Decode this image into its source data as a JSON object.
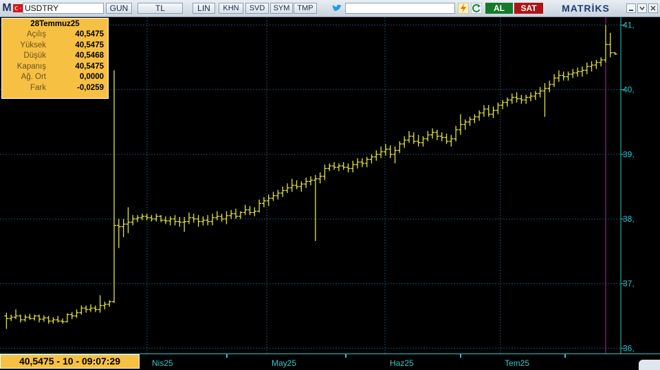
{
  "toolbar": {
    "logo_letter": "M",
    "symbol": "USDTRY",
    "buttons": [
      "GUN",
      "TL",
      "LIN",
      "KHN",
      "SVD",
      "SYM",
      "TMP"
    ],
    "buy_label": "AL",
    "sell_label": "SAT",
    "brand": "MATRİKS",
    "icons": [
      "flag-icon",
      "twitter-icon",
      "lightning-icon",
      "refresh-icon",
      "minimize-icon",
      "restore-icon",
      "close-icon"
    ]
  },
  "info_box": {
    "date": "28Temmuz25",
    "rows": [
      {
        "label": "Açılış",
        "value": "40,5475"
      },
      {
        "label": "Yüksek",
        "value": "40,5475"
      },
      {
        "label": "Düşük",
        "value": "40,5468"
      },
      {
        "label": "Kapanış",
        "value": "40,5475"
      },
      {
        "label": "Ağ. Ort",
        "value": "0,0000"
      },
      {
        "label": "Fark",
        "value": "-0,0259"
      }
    ]
  },
  "readout": "40,5475 - 10 - 09:07:29",
  "colors": {
    "background": "#000000",
    "bars": "#e6e63a",
    "grid": "#1f4a66",
    "axis": "#30c8d0",
    "info_bg": "#f6c043",
    "buy": "#157a2a",
    "sell": "#b01414"
  },
  "chart_data": {
    "type": "ohlc",
    "y_tick_labels": [
      "36,",
      "37,",
      "38,",
      "39,",
      "40,",
      "41,"
    ],
    "ylim": [
      35.95,
      41.1
    ],
    "x_tick_labels": [
      "Nis25",
      "May25",
      "Haz25",
      "Tem25"
    ],
    "x_ticks": [
      "Nis25",
      "May25",
      "Haz25",
      "Tem25"
    ],
    "series": [
      {
        "values": [
          [
            36.5,
            36.55,
            36.3,
            36.46
          ],
          [
            36.46,
            36.52,
            36.42,
            36.48
          ],
          [
            36.48,
            36.6,
            36.45,
            36.5
          ],
          [
            36.5,
            36.52,
            36.4,
            36.44
          ],
          [
            36.44,
            36.52,
            36.41,
            36.48
          ],
          [
            36.48,
            36.53,
            36.44,
            36.46
          ],
          [
            36.46,
            36.52,
            36.43,
            36.5
          ],
          [
            36.5,
            36.52,
            36.4,
            36.45
          ],
          [
            36.45,
            36.51,
            36.41,
            36.47
          ],
          [
            36.47,
            36.5,
            36.38,
            36.42
          ],
          [
            36.42,
            36.48,
            36.38,
            36.44
          ],
          [
            36.44,
            36.5,
            36.4,
            36.42
          ],
          [
            36.42,
            36.46,
            36.38,
            36.41
          ],
          [
            36.41,
            36.54,
            36.4,
            36.52
          ],
          [
            36.52,
            36.56,
            36.45,
            36.5
          ],
          [
            36.5,
            36.6,
            36.47,
            36.55
          ],
          [
            36.55,
            36.66,
            36.52,
            36.62
          ],
          [
            36.62,
            36.66,
            36.55,
            36.6
          ],
          [
            36.6,
            36.68,
            36.56,
            36.62
          ],
          [
            36.62,
            36.66,
            36.56,
            36.6
          ],
          [
            36.6,
            36.82,
            36.55,
            36.66
          ],
          [
            36.66,
            36.72,
            36.6,
            36.68
          ],
          [
            36.68,
            36.74,
            36.64,
            36.72
          ],
          [
            36.72,
            40.3,
            36.7,
            37.9
          ],
          [
            37.9,
            38.0,
            37.55,
            37.88
          ],
          [
            37.88,
            38.0,
            37.72,
            37.92
          ],
          [
            37.92,
            38.18,
            37.78,
            37.95
          ],
          [
            37.95,
            38.06,
            37.9,
            38.0
          ],
          [
            38.0,
            38.06,
            37.95,
            38.02
          ],
          [
            38.02,
            38.08,
            37.98,
            38.04
          ],
          [
            38.04,
            38.08,
            37.98,
            38.02
          ],
          [
            38.02,
            38.06,
            37.96,
            38.0
          ],
          [
            38.0,
            38.08,
            37.96,
            38.04
          ],
          [
            38.04,
            38.06,
            37.95,
            37.98
          ],
          [
            37.98,
            38.04,
            37.92,
            37.97
          ],
          [
            37.97,
            38.04,
            37.9,
            38.0
          ],
          [
            38.0,
            38.06,
            37.9,
            37.96
          ],
          [
            37.96,
            38.03,
            37.88,
            37.95
          ],
          [
            37.95,
            38.03,
            37.8,
            37.96
          ],
          [
            37.96,
            38.1,
            37.92,
            38.02
          ],
          [
            38.02,
            38.08,
            37.94,
            38.0
          ],
          [
            38.0,
            38.06,
            37.88,
            37.96
          ],
          [
            37.96,
            38.04,
            37.9,
            37.98
          ],
          [
            37.98,
            38.06,
            37.9,
            37.96
          ],
          [
            37.96,
            38.08,
            37.9,
            38.02
          ],
          [
            38.02,
            38.12,
            37.98,
            38.04
          ],
          [
            38.04,
            38.08,
            37.96,
            38.0
          ],
          [
            38.0,
            38.12,
            37.92,
            38.05
          ],
          [
            38.05,
            38.14,
            38.0,
            38.08
          ],
          [
            38.08,
            38.16,
            38.0,
            38.04
          ],
          [
            38.04,
            38.12,
            38.0,
            38.1
          ],
          [
            38.1,
            38.22,
            38.06,
            38.14
          ],
          [
            38.14,
            38.2,
            38.06,
            38.1
          ],
          [
            38.1,
            38.18,
            38.04,
            38.12
          ],
          [
            38.12,
            38.3,
            38.1,
            38.24
          ],
          [
            38.24,
            38.34,
            38.18,
            38.28
          ],
          [
            38.28,
            38.38,
            38.2,
            38.32
          ],
          [
            38.32,
            38.42,
            38.28,
            38.36
          ],
          [
            38.36,
            38.45,
            38.3,
            38.4
          ],
          [
            38.4,
            38.5,
            38.34,
            38.44
          ],
          [
            38.44,
            38.55,
            38.4,
            38.48
          ],
          [
            38.48,
            38.62,
            38.42,
            38.52
          ],
          [
            38.52,
            38.6,
            38.46,
            38.5
          ],
          [
            38.5,
            38.58,
            38.42,
            38.54
          ],
          [
            38.54,
            38.64,
            38.48,
            38.58
          ],
          [
            38.58,
            38.66,
            38.52,
            38.6
          ],
          [
            38.6,
            38.68,
            37.66,
            38.62
          ],
          [
            38.62,
            38.72,
            38.55,
            38.66
          ],
          [
            38.66,
            38.84,
            38.6,
            38.78
          ],
          [
            38.78,
            38.86,
            38.74,
            38.82
          ],
          [
            38.82,
            38.88,
            38.76,
            38.8
          ],
          [
            38.8,
            38.86,
            38.74,
            38.82
          ],
          [
            38.82,
            38.88,
            38.76,
            38.8
          ],
          [
            38.8,
            38.86,
            38.72,
            38.78
          ],
          [
            38.78,
            38.9,
            38.72,
            38.84
          ],
          [
            38.84,
            38.94,
            38.78,
            38.88
          ],
          [
            38.88,
            38.94,
            38.8,
            38.86
          ],
          [
            38.86,
            38.96,
            38.8,
            38.92
          ],
          [
            38.92,
            39.0,
            38.86,
            38.96
          ],
          [
            38.96,
            39.06,
            38.9,
            39.0
          ],
          [
            39.0,
            39.12,
            38.94,
            39.04
          ],
          [
            39.04,
            39.16,
            38.98,
            39.08
          ],
          [
            39.08,
            39.14,
            38.94,
            39.0
          ],
          [
            39.0,
            39.12,
            38.86,
            39.06
          ],
          [
            39.06,
            39.2,
            39.02,
            39.16
          ],
          [
            39.16,
            39.28,
            39.1,
            39.22
          ],
          [
            39.22,
            39.36,
            39.18,
            39.28
          ],
          [
            39.28,
            39.34,
            39.16,
            39.2
          ],
          [
            39.2,
            39.3,
            39.12,
            39.18
          ],
          [
            39.18,
            39.28,
            39.12,
            39.24
          ],
          [
            39.24,
            39.36,
            39.2,
            39.3
          ],
          [
            39.3,
            39.4,
            39.24,
            39.34
          ],
          [
            39.34,
            39.38,
            39.22,
            39.28
          ],
          [
            39.28,
            39.34,
            39.2,
            39.26
          ],
          [
            39.26,
            39.32,
            39.16,
            39.2
          ],
          [
            39.2,
            39.3,
            39.12,
            39.24
          ],
          [
            39.24,
            39.44,
            39.2,
            39.38
          ],
          [
            39.38,
            39.62,
            39.3,
            39.46
          ],
          [
            39.46,
            39.54,
            39.38,
            39.5
          ],
          [
            39.5,
            39.58,
            39.44,
            39.54
          ],
          [
            39.54,
            39.62,
            39.48,
            39.58
          ],
          [
            39.58,
            39.68,
            39.52,
            39.64
          ],
          [
            39.64,
            39.76,
            39.58,
            39.7
          ],
          [
            39.7,
            39.76,
            39.58,
            39.62
          ],
          [
            39.62,
            39.74,
            39.56,
            39.68
          ],
          [
            39.68,
            39.8,
            39.62,
            39.76
          ],
          [
            39.76,
            39.84,
            39.7,
            39.8
          ],
          [
            39.8,
            39.88,
            39.74,
            39.84
          ],
          [
            39.84,
            39.94,
            39.78,
            39.88
          ],
          [
            39.88,
            39.96,
            39.8,
            39.86
          ],
          [
            39.86,
            39.92,
            39.78,
            39.84
          ],
          [
            39.84,
            39.92,
            39.78,
            39.88
          ],
          [
            39.88,
            39.96,
            39.82,
            39.9
          ],
          [
            39.9,
            39.98,
            39.84,
            39.94
          ],
          [
            39.94,
            40.04,
            39.88,
            39.98
          ],
          [
            39.98,
            40.1,
            39.58,
            40.02
          ],
          [
            40.02,
            40.14,
            39.96,
            40.08
          ],
          [
            40.08,
            40.24,
            40.04,
            40.18
          ],
          [
            40.18,
            40.3,
            40.12,
            40.22
          ],
          [
            40.22,
            40.28,
            40.14,
            40.2
          ],
          [
            40.2,
            40.28,
            40.14,
            40.24
          ],
          [
            40.24,
            40.32,
            40.18,
            40.26
          ],
          [
            40.26,
            40.34,
            40.2,
            40.28
          ],
          [
            40.28,
            40.36,
            40.2,
            40.3
          ],
          [
            40.3,
            40.42,
            40.24,
            40.36
          ],
          [
            40.36,
            40.44,
            40.28,
            40.38
          ],
          [
            40.38,
            40.46,
            40.32,
            40.42
          ],
          [
            40.42,
            40.5,
            40.36,
            40.46
          ],
          [
            40.46,
            41.0,
            40.42,
            40.7
          ],
          [
            40.7,
            40.88,
            40.5,
            40.57
          ],
          [
            40.57,
            40.58,
            40.54,
            40.55
          ]
        ]
      }
    ]
  }
}
